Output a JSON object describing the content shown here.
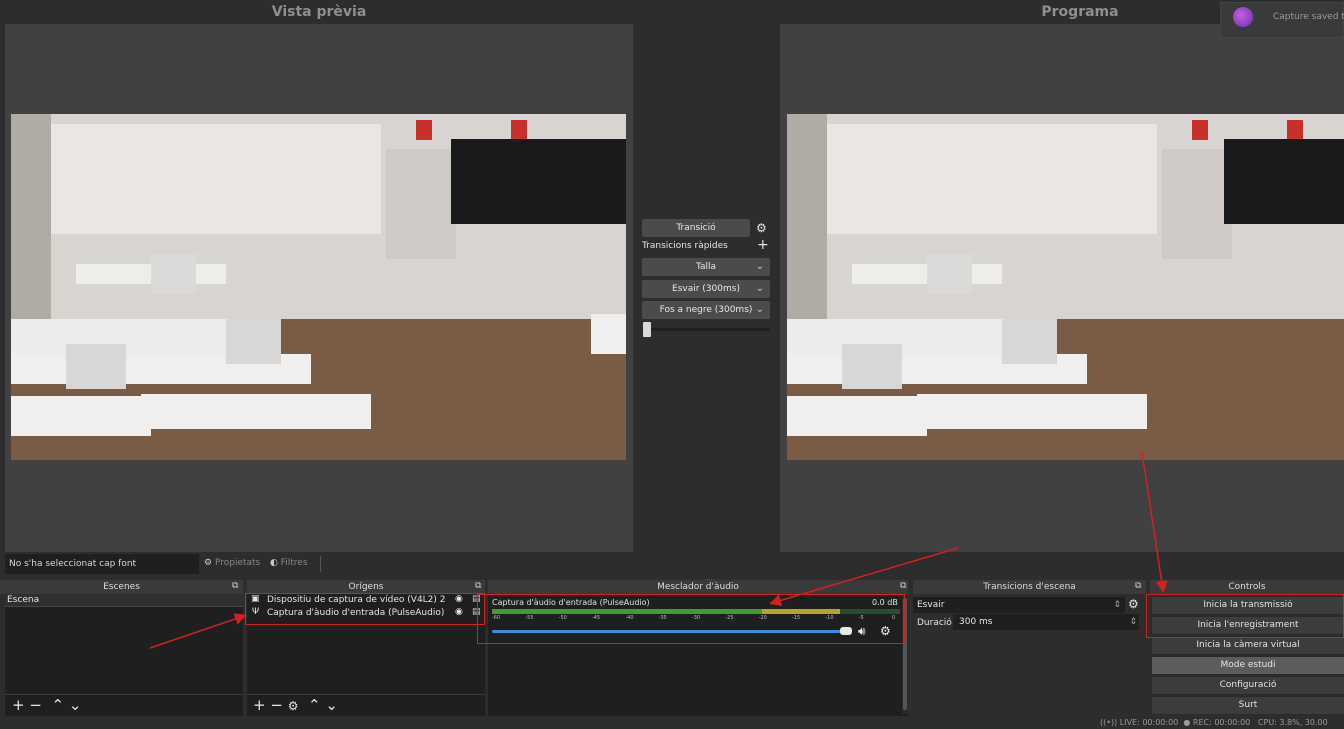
{
  "preview": {
    "title": "Vista prèvia"
  },
  "program": {
    "title": "Programa"
  },
  "toast": {
    "text": "Capture saved to"
  },
  "transition_panel": {
    "transition_label": "Transició",
    "quick_label": "Transicions ràpides",
    "items": [
      "Talla",
      "Esvair (300ms)",
      "Fos a negre (300ms)"
    ]
  },
  "source_bar": {
    "no_source": "No s'ha seleccionat cap font",
    "properties": "Propietats",
    "filters": "Filtres"
  },
  "scenes": {
    "title": "Escenes",
    "items": [
      "Escena"
    ]
  },
  "sources": {
    "title": "Orígens",
    "items": [
      "Dispositiu de captura de vídeo (V4L2) 2",
      "Captura d'àudio d'entrada (PulseAudio)"
    ]
  },
  "mixer": {
    "title": "Mesclador d'àudio",
    "channel_name": "Captura d'àudio d'entrada (PulseAudio)",
    "db": "0.0 dB",
    "ticks": [
      "-60",
      "-55",
      "-50",
      "-45",
      "-40",
      "-35",
      "-30",
      "-25",
      "-20",
      "-15",
      "-10",
      "-5",
      "0"
    ],
    "volume_fraction": 1.0
  },
  "scene_transitions": {
    "title": "Transicions d'escena",
    "selected": "Esvair",
    "duration_label": "Duració",
    "duration_value": "300 ms"
  },
  "controls": {
    "title": "Controls",
    "buttons": [
      "Inicia la transmissió",
      "Inicia l'enregistrament",
      "Inicia la càmera virtual",
      "Mode estudi",
      "Configuració",
      "Surt"
    ]
  },
  "status": {
    "live": "LIVE: 00:00:00",
    "rec": "REC: 00:00:00",
    "cpu": "CPU: 3.8%, 30.00"
  },
  "colors": {
    "annotation_red": "#d62020",
    "meter_green": "#3a9d3a",
    "meter_yellow": "#b3a32f",
    "volume_blue": "#3c8ce0"
  }
}
